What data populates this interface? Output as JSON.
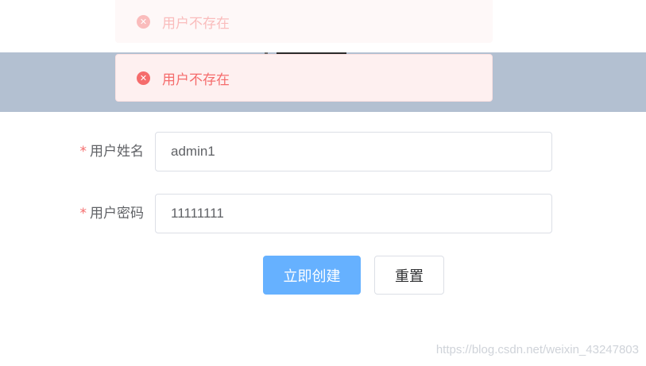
{
  "messages": [
    {
      "text": "用户不存在",
      "type": "error",
      "icon": "error-circle-icon",
      "state": "fading"
    },
    {
      "text": "用户不存在",
      "type": "error",
      "icon": "error-circle-icon",
      "state": "active"
    }
  ],
  "form": {
    "required_mark": "*",
    "username": {
      "label": "用户姓名",
      "value": "admin1"
    },
    "password": {
      "label": "用户密码",
      "value": "11111111"
    }
  },
  "buttons": {
    "create_label": "立即创建",
    "reset_label": "重置"
  },
  "watermark": "https://blog.csdn.net/weixin_43247803",
  "colors": {
    "header": "#b3c0d1",
    "error": "#f56c6c",
    "primary": "#66b1ff"
  }
}
